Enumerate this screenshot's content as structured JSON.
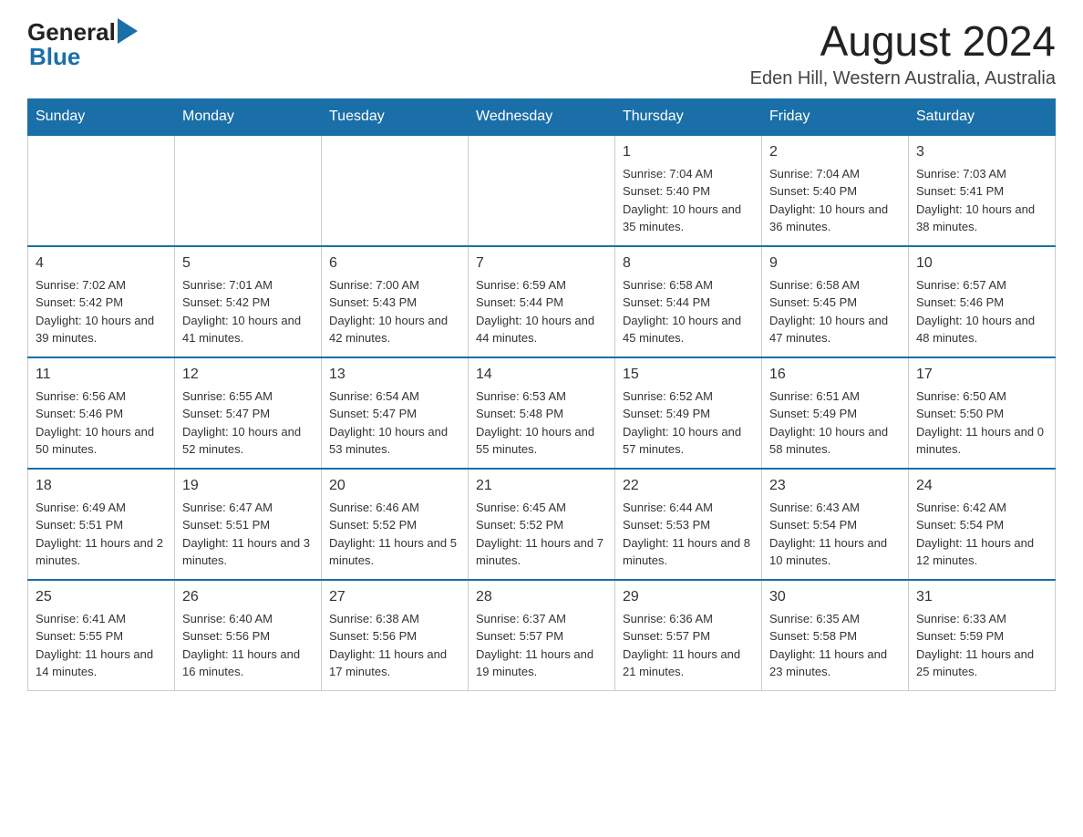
{
  "logo": {
    "general": "General",
    "blue": "Blue"
  },
  "header": {
    "month_year": "August 2024",
    "location": "Eden Hill, Western Australia, Australia"
  },
  "days_of_week": [
    "Sunday",
    "Monday",
    "Tuesday",
    "Wednesday",
    "Thursday",
    "Friday",
    "Saturday"
  ],
  "weeks": [
    [
      {
        "day": "",
        "sunrise": "",
        "sunset": "",
        "daylight": ""
      },
      {
        "day": "",
        "sunrise": "",
        "sunset": "",
        "daylight": ""
      },
      {
        "day": "",
        "sunrise": "",
        "sunset": "",
        "daylight": ""
      },
      {
        "day": "",
        "sunrise": "",
        "sunset": "",
        "daylight": ""
      },
      {
        "day": "1",
        "sunrise": "Sunrise: 7:04 AM",
        "sunset": "Sunset: 5:40 PM",
        "daylight": "Daylight: 10 hours and 35 minutes."
      },
      {
        "day": "2",
        "sunrise": "Sunrise: 7:04 AM",
        "sunset": "Sunset: 5:40 PM",
        "daylight": "Daylight: 10 hours and 36 minutes."
      },
      {
        "day": "3",
        "sunrise": "Sunrise: 7:03 AM",
        "sunset": "Sunset: 5:41 PM",
        "daylight": "Daylight: 10 hours and 38 minutes."
      }
    ],
    [
      {
        "day": "4",
        "sunrise": "Sunrise: 7:02 AM",
        "sunset": "Sunset: 5:42 PM",
        "daylight": "Daylight: 10 hours and 39 minutes."
      },
      {
        "day": "5",
        "sunrise": "Sunrise: 7:01 AM",
        "sunset": "Sunset: 5:42 PM",
        "daylight": "Daylight: 10 hours and 41 minutes."
      },
      {
        "day": "6",
        "sunrise": "Sunrise: 7:00 AM",
        "sunset": "Sunset: 5:43 PM",
        "daylight": "Daylight: 10 hours and 42 minutes."
      },
      {
        "day": "7",
        "sunrise": "Sunrise: 6:59 AM",
        "sunset": "Sunset: 5:44 PM",
        "daylight": "Daylight: 10 hours and 44 minutes."
      },
      {
        "day": "8",
        "sunrise": "Sunrise: 6:58 AM",
        "sunset": "Sunset: 5:44 PM",
        "daylight": "Daylight: 10 hours and 45 minutes."
      },
      {
        "day": "9",
        "sunrise": "Sunrise: 6:58 AM",
        "sunset": "Sunset: 5:45 PM",
        "daylight": "Daylight: 10 hours and 47 minutes."
      },
      {
        "day": "10",
        "sunrise": "Sunrise: 6:57 AM",
        "sunset": "Sunset: 5:46 PM",
        "daylight": "Daylight: 10 hours and 48 minutes."
      }
    ],
    [
      {
        "day": "11",
        "sunrise": "Sunrise: 6:56 AM",
        "sunset": "Sunset: 5:46 PM",
        "daylight": "Daylight: 10 hours and 50 minutes."
      },
      {
        "day": "12",
        "sunrise": "Sunrise: 6:55 AM",
        "sunset": "Sunset: 5:47 PM",
        "daylight": "Daylight: 10 hours and 52 minutes."
      },
      {
        "day": "13",
        "sunrise": "Sunrise: 6:54 AM",
        "sunset": "Sunset: 5:47 PM",
        "daylight": "Daylight: 10 hours and 53 minutes."
      },
      {
        "day": "14",
        "sunrise": "Sunrise: 6:53 AM",
        "sunset": "Sunset: 5:48 PM",
        "daylight": "Daylight: 10 hours and 55 minutes."
      },
      {
        "day": "15",
        "sunrise": "Sunrise: 6:52 AM",
        "sunset": "Sunset: 5:49 PM",
        "daylight": "Daylight: 10 hours and 57 minutes."
      },
      {
        "day": "16",
        "sunrise": "Sunrise: 6:51 AM",
        "sunset": "Sunset: 5:49 PM",
        "daylight": "Daylight: 10 hours and 58 minutes."
      },
      {
        "day": "17",
        "sunrise": "Sunrise: 6:50 AM",
        "sunset": "Sunset: 5:50 PM",
        "daylight": "Daylight: 11 hours and 0 minutes."
      }
    ],
    [
      {
        "day": "18",
        "sunrise": "Sunrise: 6:49 AM",
        "sunset": "Sunset: 5:51 PM",
        "daylight": "Daylight: 11 hours and 2 minutes."
      },
      {
        "day": "19",
        "sunrise": "Sunrise: 6:47 AM",
        "sunset": "Sunset: 5:51 PM",
        "daylight": "Daylight: 11 hours and 3 minutes."
      },
      {
        "day": "20",
        "sunrise": "Sunrise: 6:46 AM",
        "sunset": "Sunset: 5:52 PM",
        "daylight": "Daylight: 11 hours and 5 minutes."
      },
      {
        "day": "21",
        "sunrise": "Sunrise: 6:45 AM",
        "sunset": "Sunset: 5:52 PM",
        "daylight": "Daylight: 11 hours and 7 minutes."
      },
      {
        "day": "22",
        "sunrise": "Sunrise: 6:44 AM",
        "sunset": "Sunset: 5:53 PM",
        "daylight": "Daylight: 11 hours and 8 minutes."
      },
      {
        "day": "23",
        "sunrise": "Sunrise: 6:43 AM",
        "sunset": "Sunset: 5:54 PM",
        "daylight": "Daylight: 11 hours and 10 minutes."
      },
      {
        "day": "24",
        "sunrise": "Sunrise: 6:42 AM",
        "sunset": "Sunset: 5:54 PM",
        "daylight": "Daylight: 11 hours and 12 minutes."
      }
    ],
    [
      {
        "day": "25",
        "sunrise": "Sunrise: 6:41 AM",
        "sunset": "Sunset: 5:55 PM",
        "daylight": "Daylight: 11 hours and 14 minutes."
      },
      {
        "day": "26",
        "sunrise": "Sunrise: 6:40 AM",
        "sunset": "Sunset: 5:56 PM",
        "daylight": "Daylight: 11 hours and 16 minutes."
      },
      {
        "day": "27",
        "sunrise": "Sunrise: 6:38 AM",
        "sunset": "Sunset: 5:56 PM",
        "daylight": "Daylight: 11 hours and 17 minutes."
      },
      {
        "day": "28",
        "sunrise": "Sunrise: 6:37 AM",
        "sunset": "Sunset: 5:57 PM",
        "daylight": "Daylight: 11 hours and 19 minutes."
      },
      {
        "day": "29",
        "sunrise": "Sunrise: 6:36 AM",
        "sunset": "Sunset: 5:57 PM",
        "daylight": "Daylight: 11 hours and 21 minutes."
      },
      {
        "day": "30",
        "sunrise": "Sunrise: 6:35 AM",
        "sunset": "Sunset: 5:58 PM",
        "daylight": "Daylight: 11 hours and 23 minutes."
      },
      {
        "day": "31",
        "sunrise": "Sunrise: 6:33 AM",
        "sunset": "Sunset: 5:59 PM",
        "daylight": "Daylight: 11 hours and 25 minutes."
      }
    ]
  ]
}
